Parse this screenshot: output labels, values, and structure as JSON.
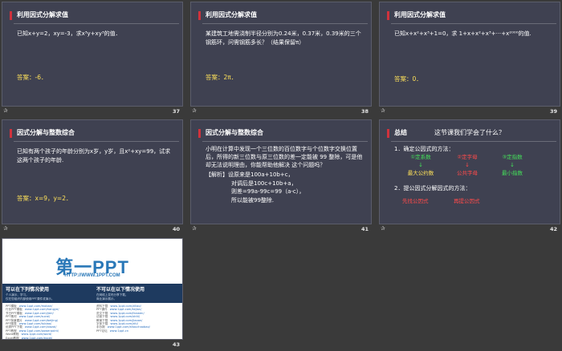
{
  "slides": [
    {
      "title": "利用因式分解求值",
      "body": "已知x+y=2，xy=-3，求x³y+xy³的值．",
      "answer": "答案：-6．",
      "number": "37"
    },
    {
      "title": "利用因式分解求值",
      "body": "某建筑工地需浇制半径分别为0.24米，0.37米，0.39米的三个钢筋环，问需钢筋多长？（结果保留π）",
      "answer": "答案：2π．",
      "number": "38"
    },
    {
      "title": "利用因式分解求值",
      "body": "已知x+x²+x³+1=0，求 1+x+x²+x³+···+x²⁰⁰⁰的值.",
      "answer": "答案：0．",
      "number": "39"
    },
    {
      "title": "因式分解与整数综合",
      "body": "已知有两个孩子的年龄分别为x岁，y岁，且x²+xy=99，试求这两个孩子的年龄.",
      "answer": "答案：x=9，y=2．",
      "number": "40"
    },
    {
      "title": "因式分解与整数综合",
      "body": "小明在计算中发现一个三位数的百位数字与个位数字交换位置后，所得的新三位数与原三位数的差一定能被 99 整除，可是他却无法说明理由，你能帮助他解决 这个问题吗？",
      "solution": [
        "【解析】设原来是100a+10b+c，",
        "对调后是100c+10b+a，",
        "则差=99a-99c=99（a-c），",
        "所以能被99整除."
      ],
      "number": "41"
    },
    {
      "title": "总结",
      "subtitle": "这节课我们学会了什么？",
      "step1": "1．确定公因式的方法：",
      "items": [
        {
          "top": "①定系数",
          "bottom": "最大公约数"
        },
        {
          "top": "②定字母",
          "bottom": "公共字母"
        },
        {
          "top": "③定指数",
          "bottom": "最小指数"
        }
      ],
      "step2": "2．提公因式分解因式的方法：",
      "methods": [
        "先找公因式",
        "再提公因式"
      ],
      "number": "42"
    }
  ],
  "ppt": {
    "logo": "第一PPT",
    "url": "HTTP://WWW.1PPT.COM",
    "can_title": "可以在下列情况使用",
    "can_sub": [
      "个人演示、学习。",
      "仅在您组织内部使用PPT课件或演示。"
    ],
    "cannot_title": "不可以在以下情况使用",
    "cannot_sub": [
      "在网络上发布分享下载。",
      "商业演示展示。"
    ],
    "left_rows": [
      [
        "PPT模板",
        "www.1ppt.com/moban/"
      ],
      [
        "行业PPT模板",
        "www.1ppt.com/hangye/"
      ],
      [
        "节日PPT模板",
        "www.1ppt.com/jieri/"
      ],
      [
        "PPT素材",
        "www.1ppt.com/sucai/"
      ],
      [
        "PPT背景图片",
        "www.1ppt.com/beijing/"
      ],
      [
        "PPT图表",
        "www.1ppt.com/tubiao/"
      ],
      [
        "优秀PPT下载",
        "www.1ppt.com/xiazai/"
      ],
      [
        "PPT教程",
        "www.1ppt.com/powerpoint/"
      ],
      [
        "Word教程",
        "www.1ppt.com/word/"
      ],
      [
        "Excel教程",
        "www.1ppt.com/excel/"
      ]
    ],
    "right_rows": [
      [
        "资料下载",
        "www.1ppt.com/ziliao/"
      ],
      [
        "PPT课件",
        "www.1ppt.com/kejian/"
      ],
      [
        "范文下载",
        "www.1ppt.com/fanwen/"
      ],
      [
        "试卷下载",
        "www.1ppt.com/shiti/"
      ],
      [
        "教案下载",
        "www.1ppt.com/jiaoan/"
      ],
      [
        "字体下载",
        "www.1ppt.com/ziti/"
      ],
      [
        "手抄报",
        "www.1ppt.com/shouchaobao/"
      ],
      [
        "PPT论坛",
        "www.1ppt.cn"
      ]
    ],
    "number": "43"
  }
}
